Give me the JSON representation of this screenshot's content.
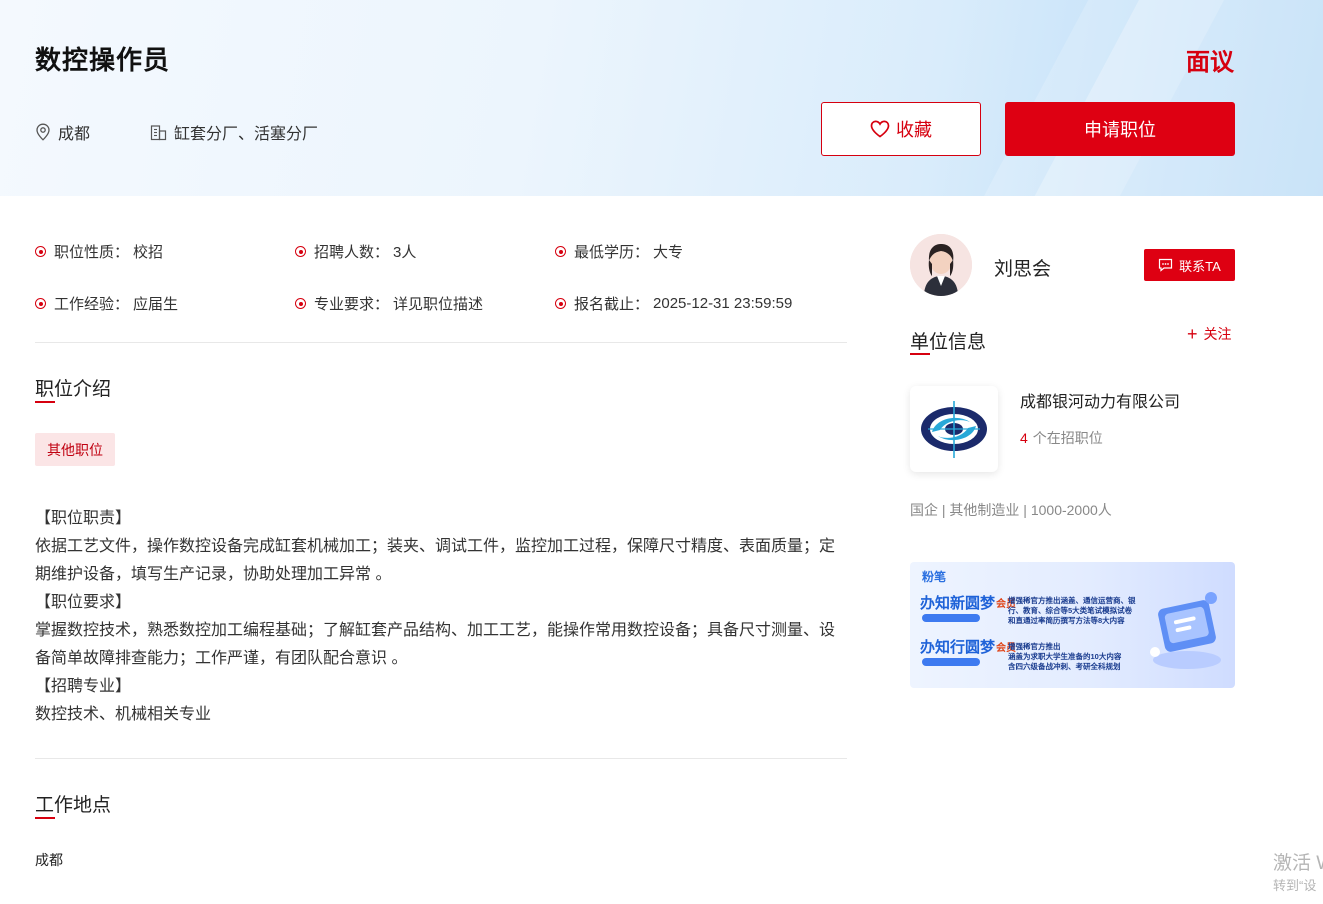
{
  "job": {
    "title": "数控操作员",
    "salary": "面议",
    "city": "成都",
    "department": "缸套分厂、活塞分厂",
    "favorite_label": "收藏",
    "apply_label": "申请职位"
  },
  "attributes": [
    {
      "label": "职位性质：",
      "value": "校招"
    },
    {
      "label": "招聘人数：",
      "value": "3人"
    },
    {
      "label": "最低学历：",
      "value": "大专"
    },
    {
      "label": "工作经验：",
      "value": "应届生"
    },
    {
      "label": "专业要求：",
      "value": "详见职位描述"
    },
    {
      "label": "报名截止：",
      "value": "2025-12-31 23:59:59"
    }
  ],
  "intro": {
    "title": "职位介绍",
    "tag": "其他职位",
    "lines": [
      "【职位职责】",
      "依据工艺文件，操作数控设备完成缸套机械加工；装夹、调试工件，监控加工过程，保障尺寸精度、表面质量；定期维护设备，填写生产记录，协助处理加工异常 。",
      "【职位要求】",
      "掌握数控技术，熟悉数控加工编程基础；了解缸套产品结构、加工工艺，能操作常用数控设备；具备尺寸测量、设备简单故障排查能力；工作严谨，有团队配合意识 。",
      "【招聘专业】",
      "数控技术、机械相关专业"
    ]
  },
  "location": {
    "title": "工作地点",
    "value": "成都"
  },
  "contact": {
    "name": "刘思会",
    "button_label": "联系TA"
  },
  "unit": {
    "title": "单位信息",
    "follow_label": "关注",
    "company_name": "成都银河动力有限公司",
    "open_count": "4",
    "open_label": "个在招职位",
    "meta": "国企 | 其他制造业 | 1000-2000人"
  },
  "banner": {
    "brand": "粉笔",
    "row1_big": "办知新圆梦",
    "row1_accent": "会员",
    "row1_text": "增强稀官方推出涵盖、通信运营商、银行、教育、综合等5大类笔试模拟试卷\n和直通过率简历撰写方法等8大内容",
    "row2_big": "办知行圆梦",
    "row2_accent": "会员",
    "row2_text": "增强稀官方推出\n涵盖为求职大学生准备的10大内容\n含四六级备战冲刺、考研全科规划"
  },
  "watermark": {
    "line1": "激活 W",
    "line2": "转到“设"
  },
  "colors": {
    "accent": "#de0012",
    "tag_bg": "#fbe5e6"
  }
}
